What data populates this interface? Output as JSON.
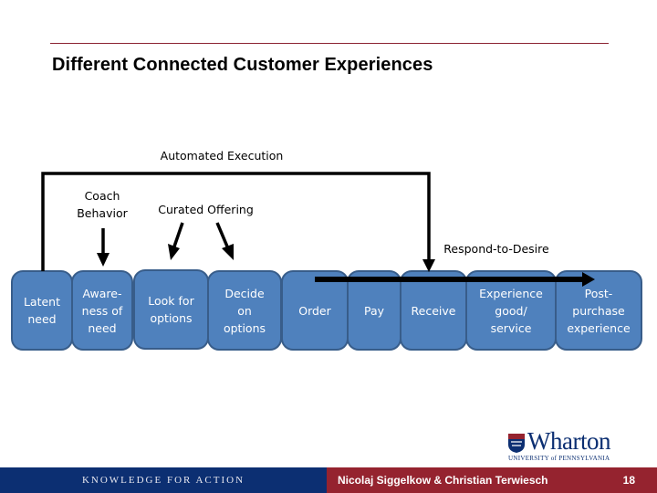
{
  "slide": {
    "title": "Different Connected Customer Experiences",
    "page_number": "18"
  },
  "labels": {
    "automated_execution": "Automated Execution",
    "coach_behavior_line1": "Coach",
    "coach_behavior_line2": "Behavior",
    "curated_offering": "Curated Offering",
    "respond_to_desire": "Respond-to-Desire"
  },
  "steps": [
    {
      "id": "latent-need",
      "lines": [
        "Latent",
        "need"
      ]
    },
    {
      "id": "awareness-of-need",
      "lines": [
        "Aware-",
        "ness of",
        "need"
      ]
    },
    {
      "id": "look-for-options",
      "lines": [
        "Look for",
        "options"
      ]
    },
    {
      "id": "decide-on-options",
      "lines": [
        "Decide",
        "on",
        "options"
      ]
    },
    {
      "id": "order",
      "lines": [
        "Order"
      ]
    },
    {
      "id": "pay",
      "lines": [
        "Pay"
      ]
    },
    {
      "id": "receive",
      "lines": [
        "Receive"
      ]
    },
    {
      "id": "experience-good-service",
      "lines": [
        "Experience",
        "good/",
        "service"
      ]
    },
    {
      "id": "post-purchase-experience",
      "lines": [
        "Post-",
        "purchase",
        "experience"
      ]
    }
  ],
  "footer": {
    "tagline": "KNOWLEDGE FOR ACTION",
    "authors": "Nicolaj Siggelkow & Christian Terwiesch",
    "logo_word": "Wharton",
    "logo_sub": "UNIVERSITY of PENNSYLVANIA"
  },
  "colors": {
    "box_fill": "#4f81bd",
    "box_border": "#385d8a",
    "footer_blue": "#0c2f72",
    "footer_red": "#95232f",
    "rule": "#8b2332"
  }
}
